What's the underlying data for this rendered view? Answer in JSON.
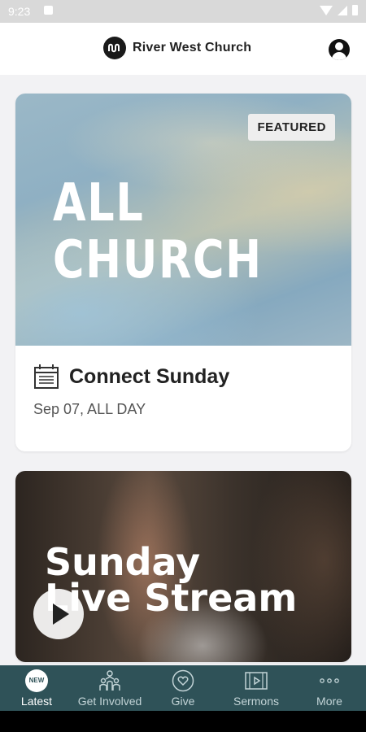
{
  "status_bar": {
    "time": "9:23"
  },
  "header": {
    "brand": "River West Church"
  },
  "featured_card": {
    "badge": "FEATURED",
    "hero_line1": "ALL",
    "hero_line2": "CHURCH",
    "event_title": "Connect Sunday",
    "event_date": "Sep 07, ALL DAY"
  },
  "live_card": {
    "line1": "Sunday",
    "line2": "Live Stream"
  },
  "bottom_nav": {
    "new_badge": "NEW",
    "items": [
      {
        "label": "Latest"
      },
      {
        "label": "Get Involved"
      },
      {
        "label": "Give"
      },
      {
        "label": "Sermons"
      },
      {
        "label": "More"
      }
    ]
  },
  "colors": {
    "nav_bg": "#2f5258",
    "brand_dark": "#1a1a1a"
  }
}
